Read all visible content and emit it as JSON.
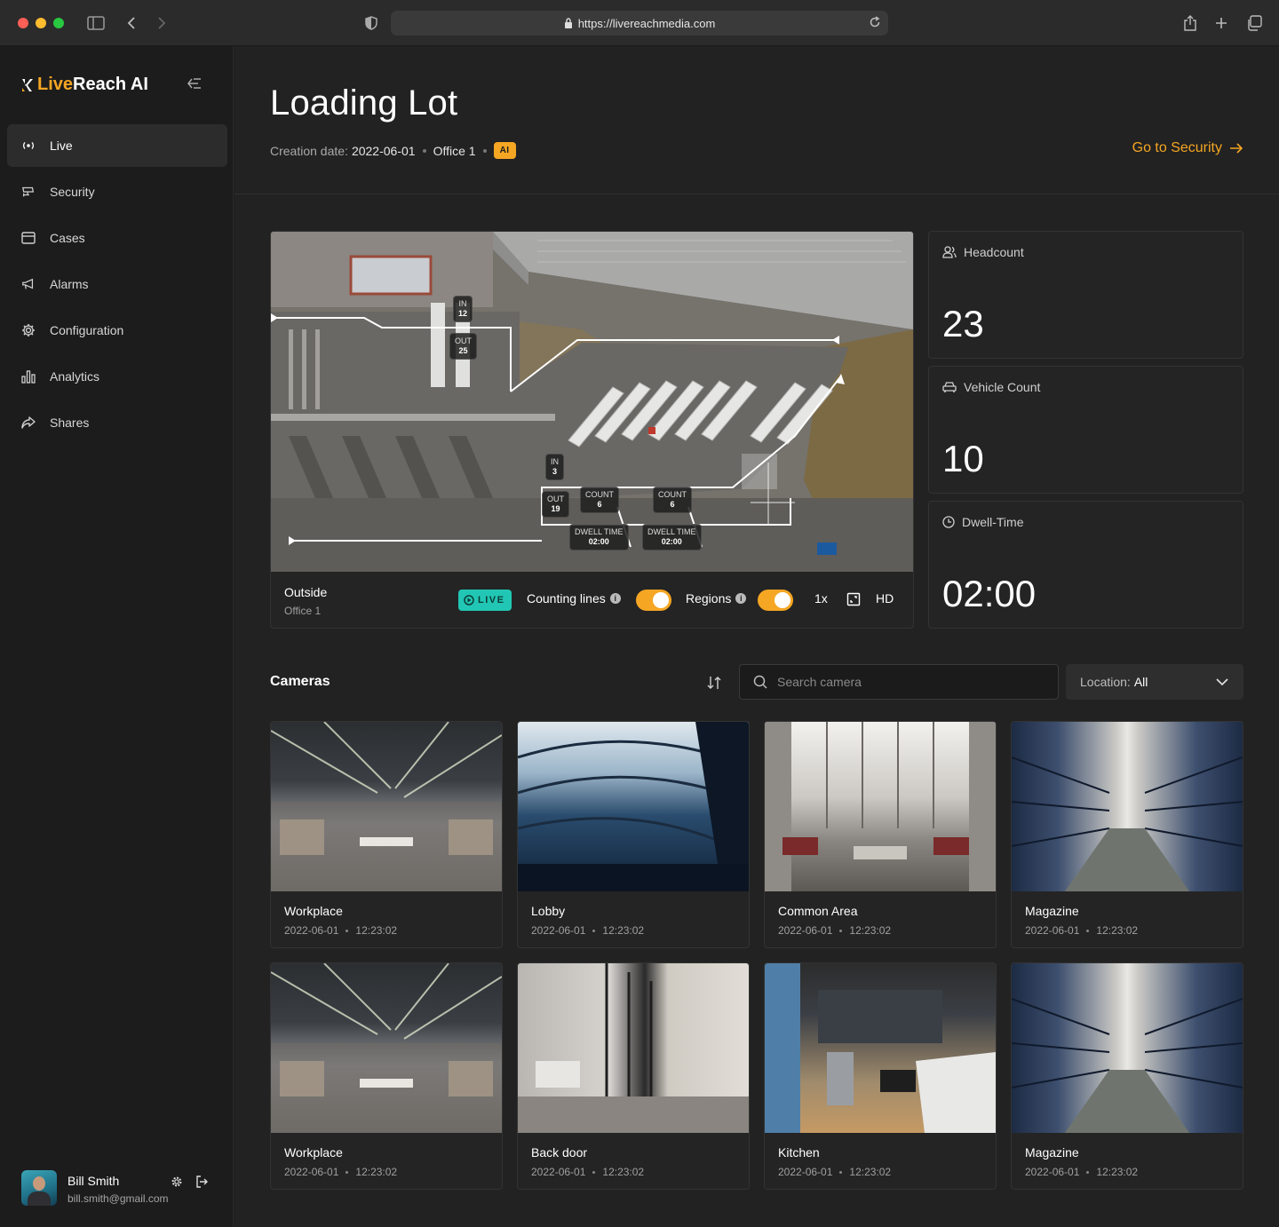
{
  "browser": {
    "url": "https://livereachmedia.com"
  },
  "brand": {
    "live": "Live",
    "rest": "Reach AI"
  },
  "sidebar": {
    "items": [
      {
        "label": "Live",
        "icon": "live-broadcast-icon",
        "active": true
      },
      {
        "label": "Security",
        "icon": "cctv-camera-icon"
      },
      {
        "label": "Cases",
        "icon": "folder-icon"
      },
      {
        "label": "Alarms",
        "icon": "megaphone-icon"
      },
      {
        "label": "Configuration",
        "icon": "gear-icon"
      },
      {
        "label": "Analytics",
        "icon": "bar-chart-icon"
      },
      {
        "label": "Shares",
        "icon": "share-arrow-icon"
      }
    ]
  },
  "user": {
    "name": "Bill Smith",
    "email": "bill.smith@gmail.com"
  },
  "header": {
    "title": "Loading Lot",
    "creation_label": "Creation date:",
    "creation_date": "2022-06-01",
    "location": "Office 1",
    "badge": "AI",
    "goto": "Go to Security"
  },
  "video": {
    "camera_name": "Outside",
    "camera_location": "Office 1",
    "live_label": "LIVE",
    "counting_lines_label": "Counting lines",
    "counting_lines_on": true,
    "regions_label": "Regions",
    "regions_on": true,
    "speed": "1x",
    "quality": "HD",
    "overlays": [
      {
        "label": "IN",
        "value": "12"
      },
      {
        "label": "OUT",
        "value": "25"
      },
      {
        "label": "IN",
        "value": "3"
      },
      {
        "label": "OUT",
        "value": "19"
      },
      {
        "label": "COUNT",
        "value": "6"
      },
      {
        "label": "COUNT",
        "value": "6"
      },
      {
        "label": "DWELL TIME",
        "value": "02:00"
      },
      {
        "label": "DWELL TIME",
        "value": "02:00"
      }
    ]
  },
  "stats": [
    {
      "label": "Headcount",
      "value": "23",
      "icon": "users-icon"
    },
    {
      "label": "Vehicle Count",
      "value": "10",
      "icon": "car-icon"
    },
    {
      "label": "Dwell-Time",
      "value": "02:00",
      "icon": "clock-icon"
    }
  ],
  "cameras_section": {
    "title": "Cameras",
    "search_placeholder": "Search camera",
    "location_label": "Location:",
    "location_value": "All"
  },
  "cameras": [
    {
      "name": "Workplace",
      "date": "2022-06-01",
      "time": "12:23:02"
    },
    {
      "name": "Lobby",
      "date": "2022-06-01",
      "time": "12:23:02"
    },
    {
      "name": "Common Area",
      "date": "2022-06-01",
      "time": "12:23:02"
    },
    {
      "name": "Magazine",
      "date": "2022-06-01",
      "time": "12:23:02"
    },
    {
      "name": "Workplace",
      "date": "2022-06-01",
      "time": "12:23:02"
    },
    {
      "name": "Back door",
      "date": "2022-06-01",
      "time": "12:23:02"
    },
    {
      "name": "Kitchen",
      "date": "2022-06-01",
      "time": "12:23:02"
    },
    {
      "name": "Magazine",
      "date": "2022-06-01",
      "time": "12:23:02"
    }
  ]
}
